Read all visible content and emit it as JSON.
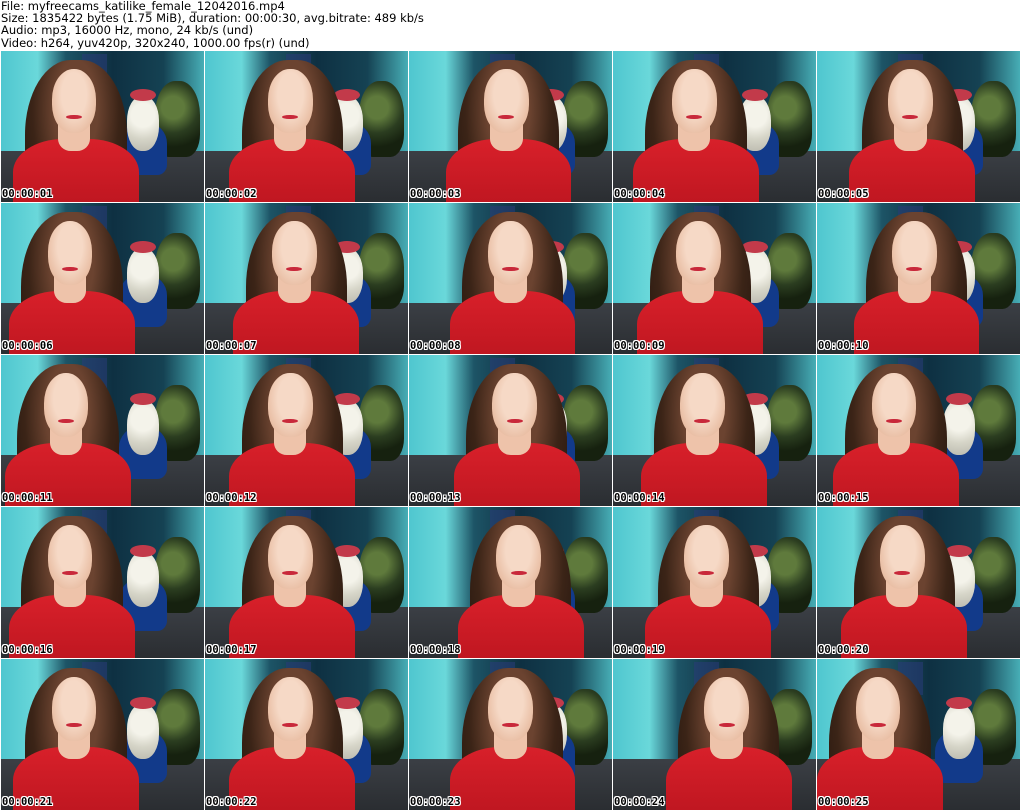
{
  "header": {
    "file": "File: myfreecams_katilike_female_12042016.mp4",
    "size": "Size: 1835422 bytes (1.75 MiB), duration: 00:00:30, avg.bitrate: 489 kb/s",
    "audio": "Audio: mp3, 16000 Hz, mono, 24 kb/s (und)",
    "video": "Video: h264, yuv420p, 320x240, 1000.00 fps(r) (und)"
  },
  "frames": [
    {
      "ts": "00:00:01"
    },
    {
      "ts": "00:00:02"
    },
    {
      "ts": "00:00:03"
    },
    {
      "ts": "00:00:04"
    },
    {
      "ts": "00:00:05"
    },
    {
      "ts": "00:00:06"
    },
    {
      "ts": "00:00:07"
    },
    {
      "ts": "00:00:08"
    },
    {
      "ts": "00:00:09"
    },
    {
      "ts": "00:00:10"
    },
    {
      "ts": "00:00:11"
    },
    {
      "ts": "00:00:12"
    },
    {
      "ts": "00:00:13"
    },
    {
      "ts": "00:00:14"
    },
    {
      "ts": "00:00:15"
    },
    {
      "ts": "00:00:16"
    },
    {
      "ts": "00:00:17"
    },
    {
      "ts": "00:00:18"
    },
    {
      "ts": "00:00:19"
    },
    {
      "ts": "00:00:20"
    },
    {
      "ts": "00:00:21"
    },
    {
      "ts": "00:00:22"
    },
    {
      "ts": "00:00:23"
    },
    {
      "ts": "00:00:24"
    },
    {
      "ts": "00:00:25"
    }
  ]
}
